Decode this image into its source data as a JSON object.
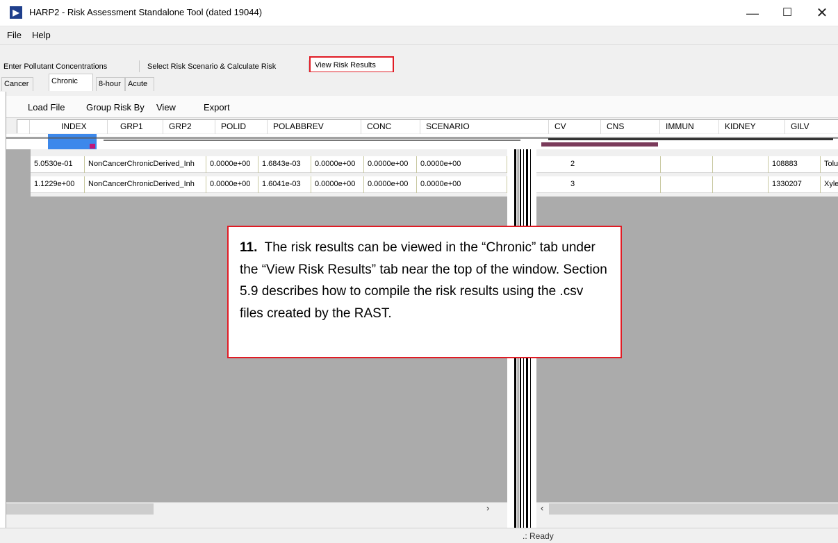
{
  "window": {
    "title": "HARP2 - Risk Assessment Standalone Tool (dated 19044)",
    "minimize": "—",
    "maximize": "☐",
    "close": "✕"
  },
  "menu": [
    "File",
    "Help"
  ],
  "top_tabs": [
    "Enter Pollutant Concentrations",
    "Select Risk Scenario & Calculate Risk",
    "View Risk Results"
  ],
  "sub_tabs": [
    "Cancer",
    "Chronic",
    "8-hour",
    "Acute"
  ],
  "toolbar": [
    "Load File",
    "Group Risk By",
    "View",
    "Export"
  ],
  "grid": {
    "columns": [
      "INDEX",
      "GRP1",
      "GRP2",
      "POLID",
      "POLABBREV",
      "CONC",
      "SCENARIO",
      "CV",
      "CNS",
      "IMMUN",
      "KIDNEY",
      "GILV"
    ],
    "rows_left": [
      [
        "5.0530e-01",
        "NonCancerChronicDerived_Inh",
        "0.0000e+00",
        "1.6843e-03",
        "0.0000e+00",
        "0.0000e+00",
        "0.0000e+00"
      ],
      [
        "1.1229e+00",
        "NonCancerChronicDerived_Inh",
        "0.0000e+00",
        "1.6041e-03",
        "0.0000e+00",
        "0.0000e+00",
        "0.0000e+00"
      ]
    ],
    "rows_right": [
      {
        "index": "2",
        "polid": "108883",
        "polabbrev": "Toluene"
      },
      {
        "index": "3",
        "polid": "1330207",
        "polabbrev": "Xylenes"
      }
    ]
  },
  "callout": {
    "step": "11.",
    "text": "The risk results can be viewed in the “Chronic” tab under the “View Risk Results” tab near the top of the window.  Section 5.9 describes how to compile the risk results using the .csv files created by the RAST."
  },
  "status": ".: Ready",
  "scroll": {
    "right_arrow": "›",
    "left_arrow": "‹"
  },
  "colors": {
    "highlight": "#e01b24",
    "gray_area": "#ababab"
  }
}
